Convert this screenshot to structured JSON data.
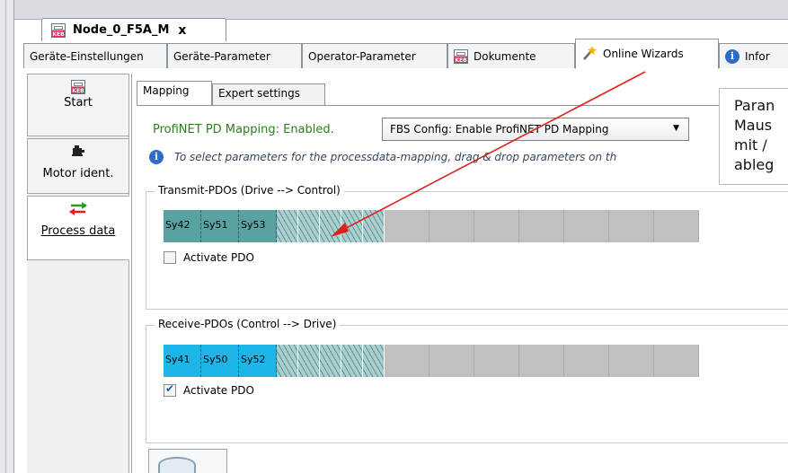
{
  "document_tab": {
    "title": "Node_0_F5A_M",
    "close_glyph": "x",
    "icon": "keb-device-icon"
  },
  "page_tabs": [
    {
      "label": "Geräte-Einstellungen",
      "icon": ""
    },
    {
      "label": "Geräte-Parameter",
      "icon": ""
    },
    {
      "label": "Operator-Parameter",
      "icon": ""
    },
    {
      "label": "Dokumente",
      "icon": "keb-document-icon"
    },
    {
      "label": "Online Wizards",
      "icon": "wand-icon"
    },
    {
      "label": "Infor",
      "icon": "info-icon"
    }
  ],
  "nav": {
    "items": [
      {
        "label": "Start",
        "icon": "keb-device-icon"
      },
      {
        "label": "Motor ident.",
        "icon": "motor-icon"
      },
      {
        "label": "Process data",
        "icon": "exchange-arrows-icon"
      }
    ]
  },
  "sub_tabs": [
    {
      "label": "Mapping"
    },
    {
      "label": "Expert settings"
    }
  ],
  "status": {
    "text": "ProfiNET PD Mapping: Enabled."
  },
  "fbs_dropdown": {
    "value": "FBS Config: Enable ProfiNET PD Mapping"
  },
  "info": {
    "text": "To select parameters for the processdata-mapping, drag & drop parameters on th"
  },
  "transmit": {
    "title": "Transmit-PDOs  (Drive --> Control)",
    "slots": [
      "Sy42",
      "Sy51",
      "Sy53"
    ],
    "activate_label": "Activate PDO",
    "activate_checked": false
  },
  "receive": {
    "title": "Receive-PDOs  (Control --> Drive)",
    "slots": [
      "Sy41",
      "Sy50",
      "Sy52"
    ],
    "activate_label": "Activate PDO",
    "activate_checked": true
  },
  "tooltip": {
    "lines": [
      "Paran",
      "Maus",
      "mit /",
      "ableg"
    ]
  },
  "trash": {
    "icon": "trash-can-icon"
  },
  "colors": {
    "status_green": "#2e7d1e",
    "tx_slot": "#58a3a2",
    "rx_slot": "#1eb5e8",
    "annotation_arrow": "#e0201c",
    "info_blue": "#2e6bc6"
  }
}
